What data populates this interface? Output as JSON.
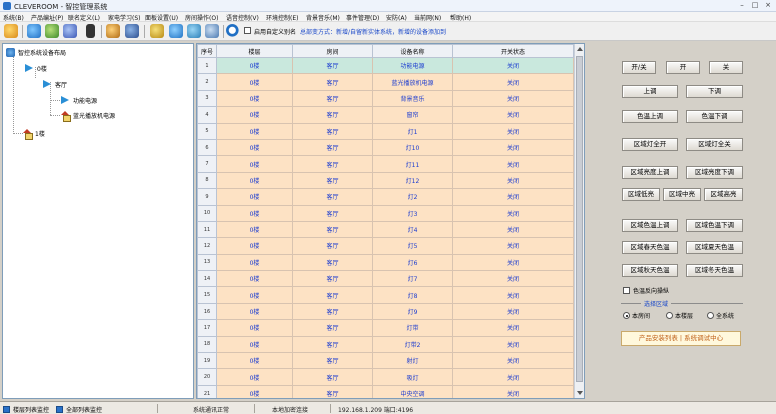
{
  "window": {
    "title": "CLEVEROOM - 智控管理系统"
  },
  "menu": [
    "系统(B)",
    "产品编址(P)",
    "联名定义(L)",
    "家电学习(S)",
    "面板设置(U)",
    "房间操作(O)",
    "语音控制(V)",
    "环境控制(E)",
    "背景音乐(M)",
    "事件管理(D)",
    "安防(A)",
    "当前网(N)",
    "帮助(H)"
  ],
  "toolbar": {
    "custom_label": "启用自定义别名",
    "hint_prefix": "总部变方式：",
    "hint_text": "新增/自留新实体系统，新增的设备添加到"
  },
  "tree": {
    "root": "智控系统设备布局",
    "floor": "0楼",
    "room": "客厅",
    "devices": [
      "功能电源",
      "蓝光播放机电源"
    ],
    "floor2": "1楼"
  },
  "grid": {
    "headers": [
      "序号",
      "楼层",
      "房间",
      "设备名称",
      "开关状态"
    ],
    "rows": [
      [
        "1",
        "0楼",
        "客厅",
        "功能电源",
        "关闭"
      ],
      [
        "2",
        "0楼",
        "客厅",
        "蓝光播放机电源",
        "关闭"
      ],
      [
        "3",
        "0楼",
        "客厅",
        "背景音乐",
        "关闭"
      ],
      [
        "4",
        "0楼",
        "客厅",
        "窗帘",
        "关闭"
      ],
      [
        "5",
        "0楼",
        "客厅",
        "灯1",
        "关闭"
      ],
      [
        "6",
        "0楼",
        "客厅",
        "灯10",
        "关闭"
      ],
      [
        "7",
        "0楼",
        "客厅",
        "灯11",
        "关闭"
      ],
      [
        "8",
        "0楼",
        "客厅",
        "灯12",
        "关闭"
      ],
      [
        "9",
        "0楼",
        "客厅",
        "灯2",
        "关闭"
      ],
      [
        "10",
        "0楼",
        "客厅",
        "灯3",
        "关闭"
      ],
      [
        "11",
        "0楼",
        "客厅",
        "灯4",
        "关闭"
      ],
      [
        "12",
        "0楼",
        "客厅",
        "灯5",
        "关闭"
      ],
      [
        "13",
        "0楼",
        "客厅",
        "灯6",
        "关闭"
      ],
      [
        "14",
        "0楼",
        "客厅",
        "灯7",
        "关闭"
      ],
      [
        "15",
        "0楼",
        "客厅",
        "灯8",
        "关闭"
      ],
      [
        "16",
        "0楼",
        "客厅",
        "灯9",
        "关闭"
      ],
      [
        "17",
        "0楼",
        "客厅",
        "灯带",
        "关闭"
      ],
      [
        "18",
        "0楼",
        "客厅",
        "灯带2",
        "关闭"
      ],
      [
        "19",
        "0楼",
        "客厅",
        "射灯",
        "关闭"
      ],
      [
        "20",
        "0楼",
        "客厅",
        "吸灯",
        "关闭"
      ],
      [
        "21",
        "0楼",
        "客厅",
        "中央空调",
        "关闭"
      ]
    ],
    "selected_row": 1
  },
  "controls": {
    "onoff": "开/关",
    "on": "开",
    "off": "关",
    "up": "上调",
    "down": "下调",
    "color_up": "色温上调",
    "color_down": "色温下调",
    "all_on": "区域灯全开",
    "all_off": "区域灯全关",
    "zone_bright_up": "区域亮度上调",
    "zone_bright_down": "区域亮度下调",
    "zone_low": "区域低亮",
    "zone_mid": "区域中亮",
    "zone_high": "区域高亮",
    "zone_color_up": "区域色温上调",
    "zone_color_down": "区域色温下调",
    "spring_color": "区域春天色温",
    "summer_color": "区域夏天色温",
    "autumn_color": "区域秋天色温",
    "winter_color": "区域冬天色温",
    "reverse_check": "色温反向操纵",
    "zone_title": "选择区域",
    "radio_room": "本房间",
    "radio_floor": "本楼层",
    "radio_all": "全系统",
    "bottom_link": "产品安装列表 | 系统调试中心"
  },
  "status": {
    "tab1": "楼层列表监控",
    "tab2": "全部列表监控",
    "field1": "系统通讯正常",
    "field2": "本地加密连接",
    "field3": "192.168.1.209  端口:4196"
  },
  "colors": {
    "row_bg": "#fde2c4",
    "selected_bg": "#c9e8dd",
    "text_blue": "#1a3bd0",
    "panel_gray": "#d4d0c8"
  }
}
